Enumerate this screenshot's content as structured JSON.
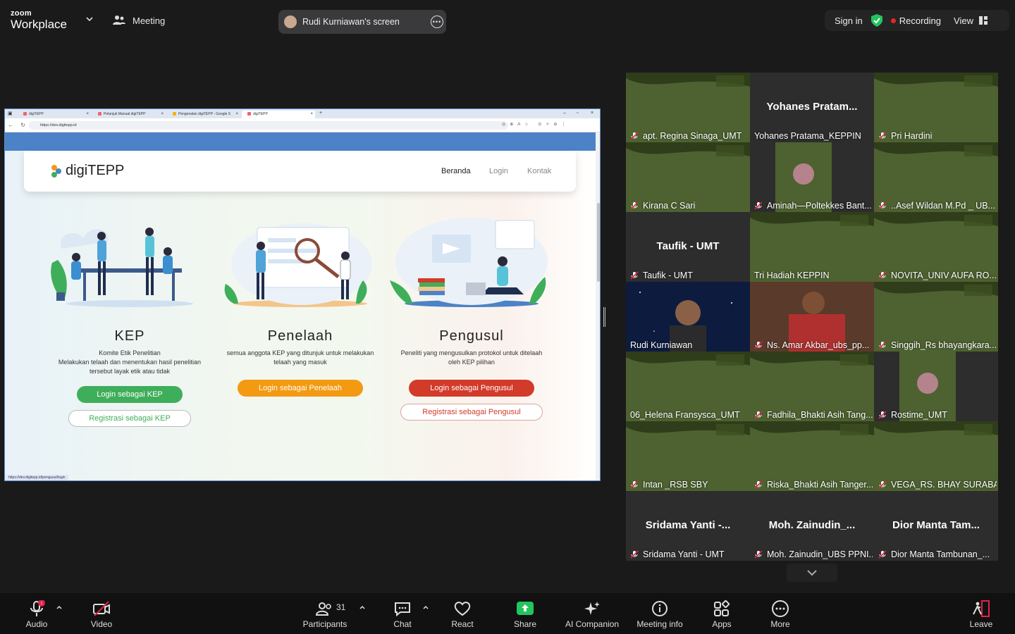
{
  "topbar": {
    "logo_line1": "zoom",
    "logo_line2": "Workplace",
    "meeting_label": "Meeting",
    "share_label": "Rudi Kurniawan's screen",
    "sign_in": "Sign in",
    "recording": "Recording",
    "view": "View",
    "colors": {
      "shield": "#22c55e",
      "recording_dot": "#e02828"
    }
  },
  "browser": {
    "tabs": [
      {
        "label": "digiTEPP",
        "active": false
      },
      {
        "label": "Petunjuk Manual digiTEPP",
        "active": false
      },
      {
        "label": "Pengenalan digiTEPP - Google S",
        "active": false
      },
      {
        "label": "digiTEPP",
        "active": true
      }
    ],
    "url": "https://dev.digitepp.id",
    "status_url": "https://dev.digitepp.id/pengusul/login"
  },
  "site": {
    "brand": "digiTEPP",
    "nav": [
      "Beranda",
      "Login",
      "Kontak"
    ],
    "columns": [
      {
        "title": "KEP",
        "desc_lines": [
          "Komite Etik Penelitian",
          "Melakukan telaah dan menentukan hasil penelitian",
          "tersebut layak etik atau tidak"
        ],
        "login_label": "Login sebagai KEP",
        "register_label": "Registrasi sebagai KEP",
        "color": "#3fae5a"
      },
      {
        "title": "Penelaah",
        "desc_lines": [
          "semua anggota KEP yang ditunjuk untuk melakukan",
          "telaah yang masuk"
        ],
        "login_label": "Login sebagai Penelaah",
        "color": "#f39a12"
      },
      {
        "title": "Pengusul",
        "desc_lines": [
          "Peneliti yang mengusulkan protokol untuk ditelaah",
          "oleh KEP pilihan"
        ],
        "login_label": "Login sebagai Pengusul",
        "register_label": "Registrasi sebagai Pengusul",
        "color": "#d23a2a"
      }
    ]
  },
  "participants": [
    {
      "name": "apt. Regina Sinaga_UMT",
      "muted": true,
      "video": "green"
    },
    {
      "name": "Yohanes Pratama_KEPPIN",
      "muted": false,
      "video": "off",
      "big": "Yohanes  Pratam..."
    },
    {
      "name": "Pri Hardini",
      "muted": true,
      "video": "green"
    },
    {
      "name": "Kirana C Sari",
      "muted": true,
      "video": "green"
    },
    {
      "name": "Aminah—Poltekkes Bant...",
      "muted": true,
      "video": "dark"
    },
    {
      "name": "..Asef Wildan M.Pd _ UB...",
      "muted": true,
      "video": "green"
    },
    {
      "name": "Taufik - UMT",
      "muted": true,
      "video": "off",
      "big": "Taufik - UMT"
    },
    {
      "name": "Tri Hadiah KEPPIN",
      "muted": false,
      "video": "green"
    },
    {
      "name": "NOVITA_UNIV AUFA RO...",
      "muted": true,
      "video": "green"
    },
    {
      "name": "Rudi Kurniawan",
      "muted": false,
      "video": "space",
      "active": true
    },
    {
      "name": "Ns. Amar Akbar_ubs_pp...",
      "muted": true,
      "video": "red"
    },
    {
      "name": "Singgih_Rs bhayangkara...",
      "muted": true,
      "video": "green"
    },
    {
      "name": "06_Helena Fransysca_UMT",
      "muted": false,
      "video": "green"
    },
    {
      "name": "Fadhila_Bhakti Asih Tang...",
      "muted": true,
      "video": "green"
    },
    {
      "name": "Rostime_UMT",
      "muted": true,
      "video": "dark"
    },
    {
      "name": "Intan _RSB SBY",
      "muted": true,
      "video": "green"
    },
    {
      "name": "Riska_Bhakti Asih Tanger...",
      "muted": true,
      "video": "green"
    },
    {
      "name": "VEGA_RS. BHAY SURABA...",
      "muted": true,
      "video": "green"
    },
    {
      "name": "Sridama Yanti - UMT",
      "muted": true,
      "video": "off",
      "big": "Sridama  Yanti  -..."
    },
    {
      "name": "Moh. Zainudin_UBS PPNI...",
      "muted": true,
      "video": "off",
      "big": "Moh.  Zainudin_..."
    },
    {
      "name": "Dior Manta Tambunan_...",
      "muted": true,
      "video": "off",
      "big": "Dior  Manta  Tam..."
    }
  ],
  "toolbar": {
    "audio": "Audio",
    "audio_badge": "!",
    "video": "Video",
    "participants": "Participants",
    "participants_count": "31",
    "chat": "Chat",
    "react": "React",
    "share": "Share",
    "ai_companion": "AI Companion",
    "meeting_info": "Meeting info",
    "apps": "Apps",
    "more": "More",
    "leave": "Leave",
    "colors": {
      "share": "#22c55e",
      "leave": "#e0244a",
      "badge": "#e0244a"
    }
  }
}
